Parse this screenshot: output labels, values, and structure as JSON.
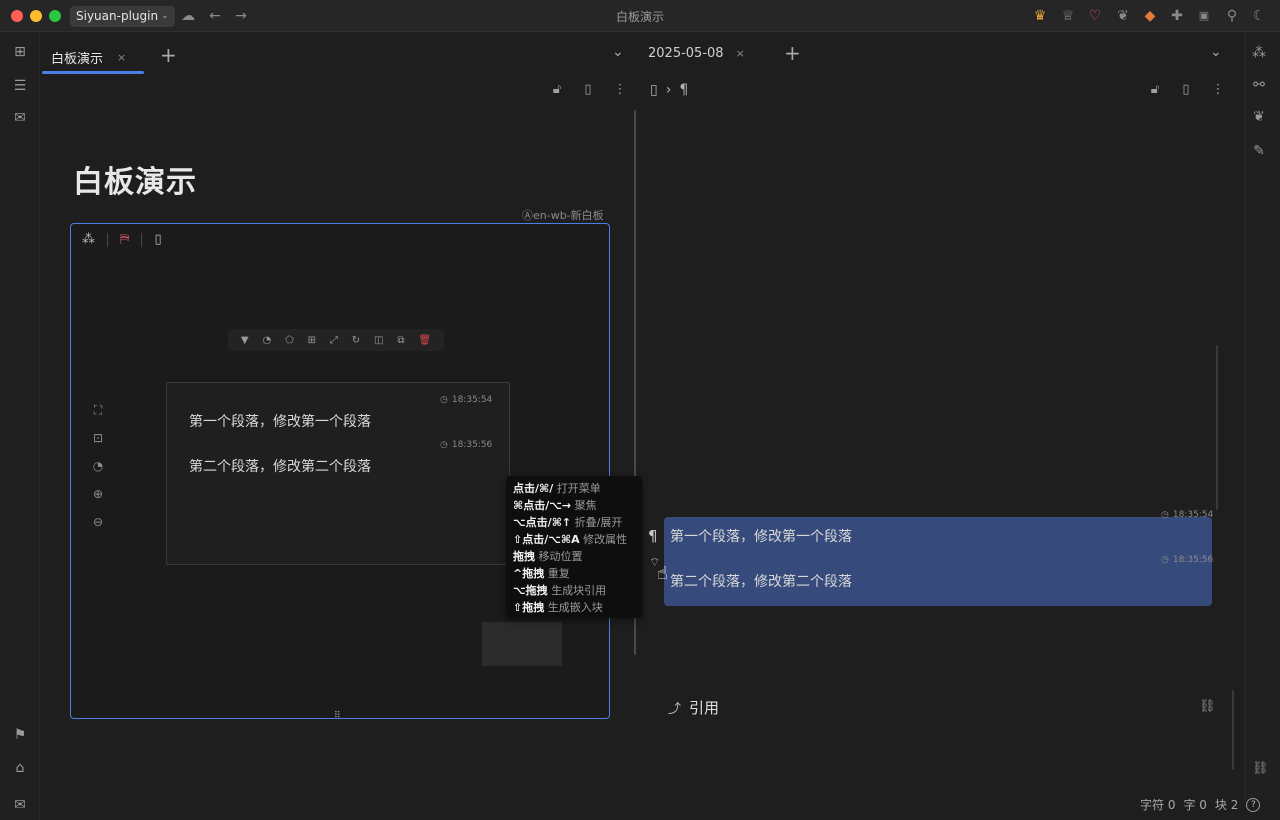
{
  "titlebar": {
    "workspace": "Siyuan-plugin",
    "window_title": "白板演示",
    "icons_left": [
      "cloud-icon",
      "back-arrow-icon",
      "forward-arrow-icon"
    ],
    "icons_right": [
      "crown-icon",
      "crown-outline-icon",
      "heart-icon",
      "leaf-icon",
      "fox-icon",
      "puzzle-icon",
      "terminal-icon",
      "search-icon",
      "moon-icon"
    ]
  },
  "tabs_left": [
    {
      "label": "白板演示",
      "active": true
    }
  ],
  "tabs_right": [
    {
      "label": "2025-05-08"
    }
  ],
  "close_glyph": "×",
  "add_glyph": "+",
  "document": {
    "title": "白板演示",
    "embed_label": "Ⓐen-wb-新白板"
  },
  "whiteboard": {
    "paragraphs": [
      {
        "text": "第一个段落，修改第一个段落",
        "time": "18:35:54"
      },
      {
        "text": "第二个段落，修改第二个段落",
        "time": "18:35:56"
      }
    ],
    "resize_handle": "⠿"
  },
  "tooltip": {
    "rows": [
      {
        "key": "点击/⌘/",
        "desc": "打开菜单"
      },
      {
        "key": "⌘点击/⌥→",
        "desc": "聚焦"
      },
      {
        "key": "⌥点击/⌘↑",
        "desc": "折叠/展开"
      },
      {
        "key": "⇧点击/⌥⌘A",
        "desc": "修改属性"
      },
      {
        "key": "拖拽",
        "desc": "移动位置"
      },
      {
        "key": "^拖拽",
        "desc": "重复"
      },
      {
        "key": "⌥拖拽",
        "desc": "生成块引用"
      },
      {
        "key": "⇧拖拽",
        "desc": "生成嵌入块"
      }
    ]
  },
  "right_pane": {
    "breadcrumb_sep": "›",
    "breadcrumb_para": "¶",
    "paragraphs": [
      {
        "text": "第一个段落，修改第一个段落",
        "time": "18:35:54"
      },
      {
        "text": "第二个段落，修改第二个段落",
        "time": "18:35:56"
      }
    ],
    "references_label": "引用"
  },
  "statusbar": {
    "chars": "字符 0",
    "words": "字 0",
    "blocks": "块 2",
    "help": "?"
  }
}
